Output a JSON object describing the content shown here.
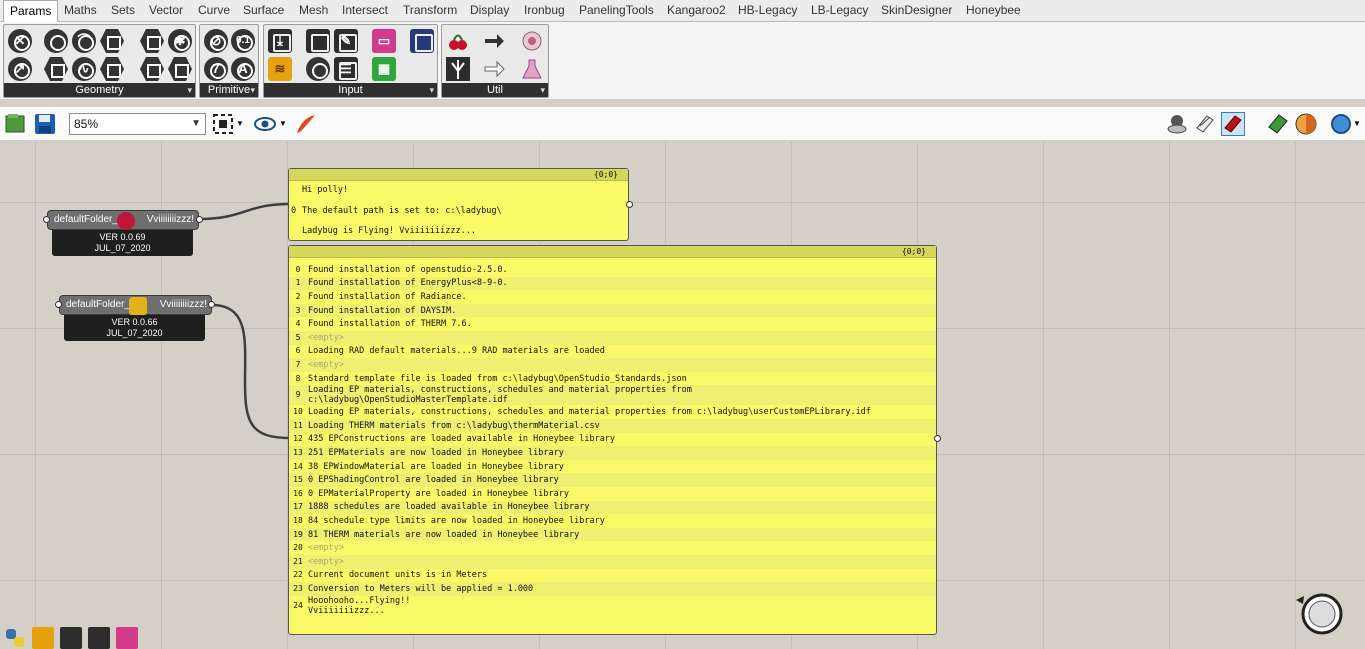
{
  "tabs": [
    "Params",
    "Maths",
    "Sets",
    "Vector",
    "Curve",
    "Surface",
    "Mesh",
    "Intersect",
    "Transform",
    "Display",
    "Ironbug",
    "PanelingTools",
    "Kangaroo2",
    "HB-Legacy",
    "LB-Legacy",
    "SkinDesigner",
    "Honeybee"
  ],
  "active_tab": "Params",
  "ribbon": {
    "geometry_label": "Geometry",
    "primitive_label": "Primitive",
    "input_label": "Input",
    "util_label": "Util",
    "primitive_glyphs": [
      "0.1",
      "7",
      "A"
    ]
  },
  "toolbar": {
    "zoom_value": "85%"
  },
  "nodes": {
    "node1": {
      "input": "defaultFolder_",
      "output": "Vviiiiiiiizzz!",
      "version": "VER 0.0.69",
      "date": "JUL_07_2020",
      "logo_color": "#c0143c"
    },
    "node2": {
      "input": "defaultFolder_",
      "output": "Vviiiiiiiizzz!",
      "version": "VER 0.0.66",
      "date": "JUL_07_2020",
      "logo_color": "#e2b21c"
    }
  },
  "panel_top": {
    "path": "{0;0}",
    "index": "0",
    "lines": [
      "Hi  polly!",
      "The default path is set to: c:\\ladybug\\",
      "Ladybug is Flying! Vviiiiiiizzz..."
    ]
  },
  "panel_main": {
    "path": "{0;0}",
    "rows": [
      {
        "i": "0",
        "t": "Found installation of openstudio-2.5.0."
      },
      {
        "i": "1",
        "t": "Found installation of EnergyPlus<8-9-0."
      },
      {
        "i": "2",
        "t": "Found installation of Radiance."
      },
      {
        "i": "3",
        "t": "Found installation of DAYSIM."
      },
      {
        "i": "4",
        "t": "Found installation of THERM 7.6."
      },
      {
        "i": "5",
        "t": "<empty>"
      },
      {
        "i": "6",
        "t": "Loading RAD default materials...9 RAD materials are loaded"
      },
      {
        "i": "7",
        "t": "<empty>"
      },
      {
        "i": "8",
        "t": "Standard template file is loaded from c:\\ladybug\\OpenStudio_Standards.json"
      },
      {
        "i": "9",
        "t": "Loading EP materials, constructions, schedules and material properties from\nc:\\ladybug\\OpenStudioMasterTemplate.idf"
      },
      {
        "i": "10",
        "t": "Loading EP materials, constructions, schedules and material properties from c:\\ladybug\\userCustomEPLibrary.idf"
      },
      {
        "i": "11",
        "t": "Loading THERM materials from c:\\ladybug\\thermMaterial.csv"
      },
      {
        "i": "12",
        "t": "435 EPConstructions are loaded available in Honeybee library"
      },
      {
        "i": "13",
        "t": "251 EPMaterials are now loaded in Honeybee library"
      },
      {
        "i": "14",
        "t": "38 EPWindowMaterial are loaded in Honeybee library"
      },
      {
        "i": "15",
        "t": "0 EPShadingControl are loaded in Honeybee library"
      },
      {
        "i": "16",
        "t": "0 EPMaterialProperty are loaded in Honeybee library"
      },
      {
        "i": "17",
        "t": "1888 schedules are loaded available in Honeybee library"
      },
      {
        "i": "18",
        "t": "84 schedule type limits are now loaded in Honeybee library"
      },
      {
        "i": "19",
        "t": "81 THERM materials are now loaded in Honeybee library"
      },
      {
        "i": "20",
        "t": "<empty>"
      },
      {
        "i": "21",
        "t": "<empty>"
      },
      {
        "i": "22",
        "t": "Current document units is in Meters"
      },
      {
        "i": "23",
        "t": "Conversion to Meters will be applied = 1.000"
      },
      {
        "i": "24",
        "t": "Hooohooho...Flying!!\nVviiiiiiizzz..."
      }
    ]
  }
}
